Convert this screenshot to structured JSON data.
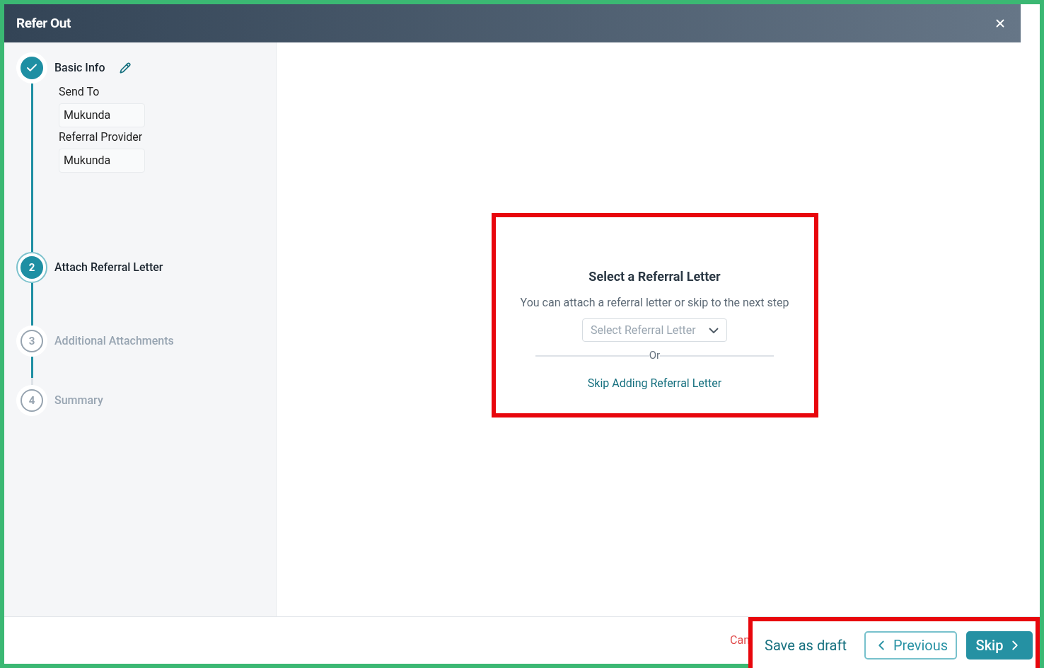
{
  "window": {
    "title": "Refer Out"
  },
  "steps": [
    {
      "kind": "completed",
      "label": "Basic Info",
      "editable": true,
      "fields": [
        {
          "label": "Send To",
          "value": "Mukunda"
        },
        {
          "label": "Referral Provider",
          "value": "Mukunda"
        }
      ]
    },
    {
      "kind": "current",
      "number": "2",
      "label": "Attach Referral Letter"
    },
    {
      "kind": "pending",
      "number": "3",
      "label": "Additional Attachments"
    },
    {
      "kind": "pending",
      "number": "4",
      "label": "Summary"
    }
  ],
  "panel": {
    "title": "Select a Referral Letter",
    "description": "You can attach a referral letter or skip to the next step",
    "select": {
      "placeholder": "Select Referral Letter"
    },
    "divider": "Or",
    "skip_link": "Skip Adding Referral Letter",
    "highlighted": true
  },
  "footer": {
    "cancel": "Can",
    "save_draft": "Save as draft",
    "previous": "Previous",
    "next": "Skip",
    "highlighted": true
  }
}
